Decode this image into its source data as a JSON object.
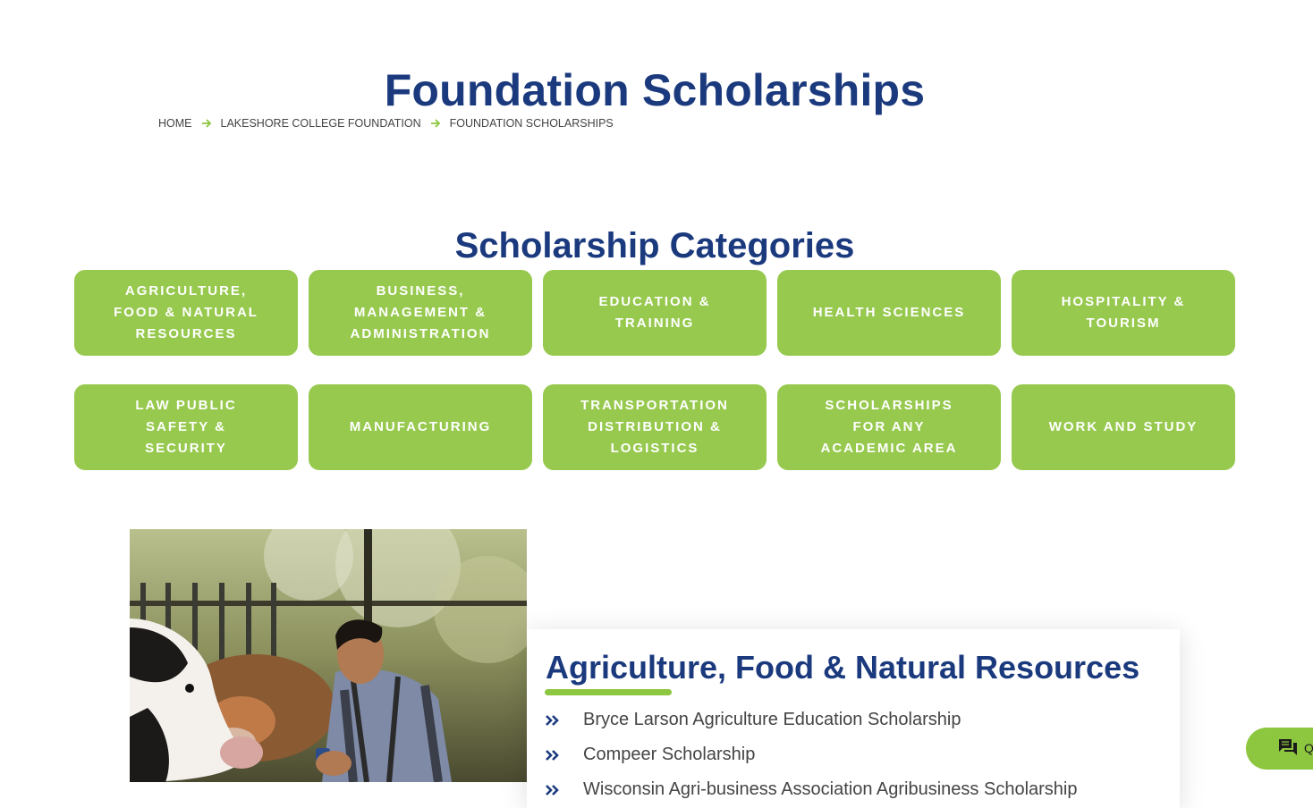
{
  "page": {
    "title": "Foundation Scholarships"
  },
  "breadcrumb": [
    {
      "label": "HOME"
    },
    {
      "label": "LAKESHORE COLLEGE FOUNDATION"
    },
    {
      "label": "FOUNDATION SCHOLARSHIPS"
    }
  ],
  "categories_section": {
    "title": "Scholarship Categories",
    "items": [
      {
        "label": "AGRICULTURE, FOOD & NATURAL RESOURCES"
      },
      {
        "label": "BUSINESS, MANAGEMENT & ADMINISTRATION"
      },
      {
        "label": "EDUCATION & TRAINING"
      },
      {
        "label": "HEALTH SCIENCES"
      },
      {
        "label": "HOSPITALITY & TOURISM"
      },
      {
        "label": "LAW PUBLIC SAFETY & SECURITY"
      },
      {
        "label": "MANUFACTURING"
      },
      {
        "label": "TRANSPORTATION DISTRIBUTION & LOGISTICS"
      },
      {
        "label": "SCHOLARSHIPS FOR ANY ACADEMIC AREA"
      },
      {
        "label": "WORK AND STUDY"
      }
    ]
  },
  "agriculture_card": {
    "title": "Agriculture, Food & Natural Resources",
    "scholarships": [
      "Bryce Larson Agriculture Education Scholarship",
      "Compeer Scholarship",
      "Wisconsin Agri-business Association Agribusiness Scholarship"
    ]
  },
  "chat_widget": {
    "label": "Q"
  },
  "colors": {
    "navy": "#1b3a7e",
    "green": "#97c94f",
    "accent_green": "#8dc63f"
  },
  "icons": {
    "breadcrumb_separator": "arrow-right-icon",
    "list_bullet": "double-chevron-right-icon",
    "chat": "chat-bubble-icon"
  }
}
